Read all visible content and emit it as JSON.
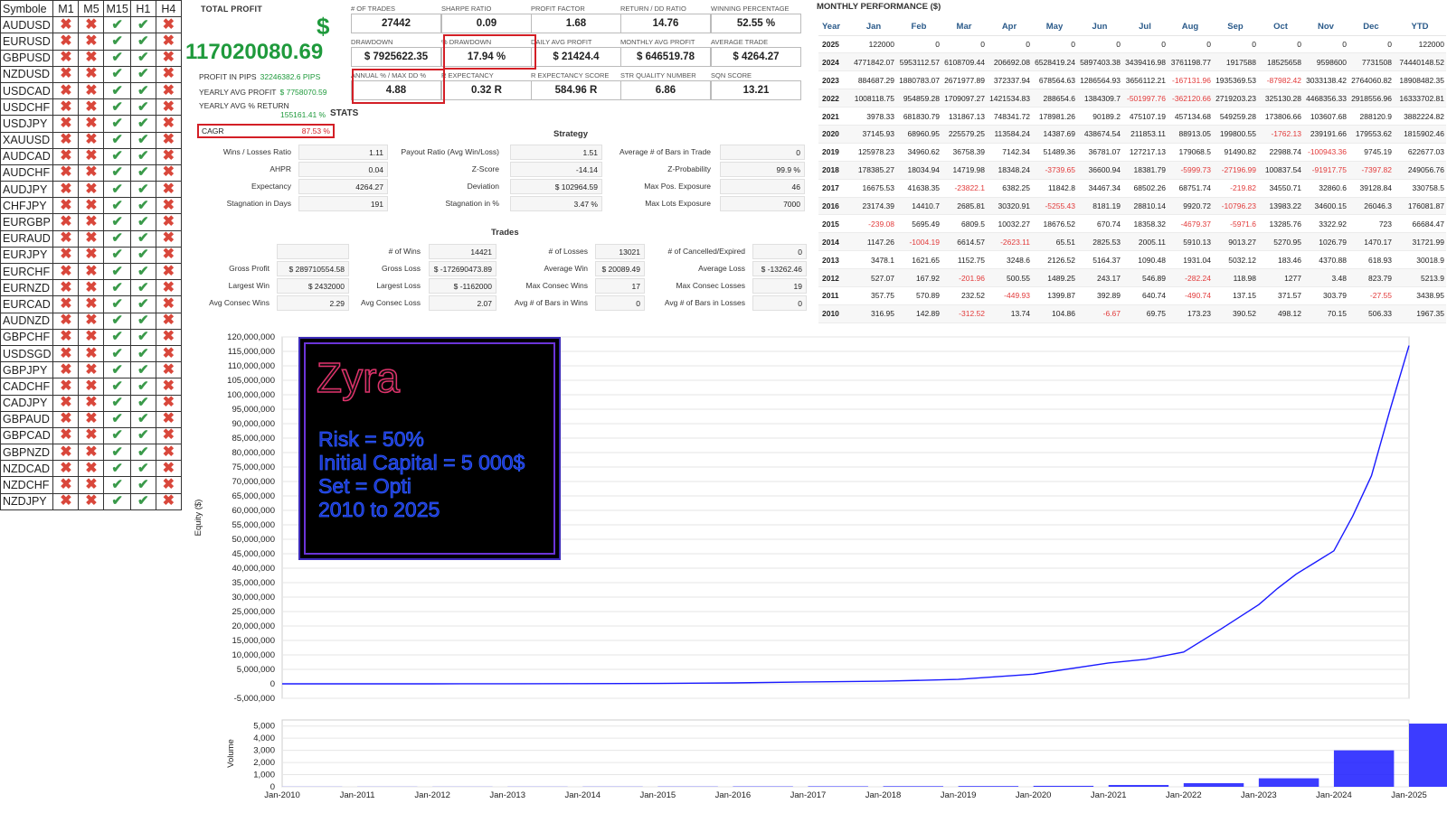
{
  "symbol_table": {
    "headers": [
      "Symbole",
      "M1",
      "M5",
      "M15",
      "H1",
      "H4"
    ],
    "rows": [
      {
        "symbol": "AUDUSD",
        "marks": [
          "x",
          "x",
          "ok",
          "ok",
          "x"
        ]
      },
      {
        "symbol": "EURUSD",
        "marks": [
          "x",
          "x",
          "ok",
          "ok",
          "x"
        ]
      },
      {
        "symbol": "GBPUSD",
        "marks": [
          "x",
          "x",
          "ok",
          "ok",
          "x"
        ]
      },
      {
        "symbol": "NZDUSD",
        "marks": [
          "x",
          "x",
          "ok",
          "ok",
          "x"
        ]
      },
      {
        "symbol": "USDCAD",
        "marks": [
          "x",
          "x",
          "ok",
          "ok",
          "x"
        ]
      },
      {
        "symbol": "USDCHF",
        "marks": [
          "x",
          "x",
          "ok",
          "ok",
          "x"
        ]
      },
      {
        "symbol": "USDJPY",
        "marks": [
          "x",
          "x",
          "ok",
          "ok",
          "x"
        ]
      },
      {
        "symbol": "XAUUSD",
        "marks": [
          "x",
          "x",
          "ok",
          "ok",
          "x"
        ]
      },
      {
        "symbol": "AUDCAD",
        "marks": [
          "x",
          "x",
          "ok",
          "ok",
          "x"
        ]
      },
      {
        "symbol": "AUDCHF",
        "marks": [
          "x",
          "x",
          "ok",
          "ok",
          "x"
        ]
      },
      {
        "symbol": "AUDJPY",
        "marks": [
          "x",
          "x",
          "ok",
          "ok",
          "x"
        ]
      },
      {
        "symbol": "CHFJPY",
        "marks": [
          "x",
          "x",
          "ok",
          "ok",
          "x"
        ]
      },
      {
        "symbol": "EURGBP",
        "marks": [
          "x",
          "x",
          "ok",
          "ok",
          "x"
        ]
      },
      {
        "symbol": "EURAUD",
        "marks": [
          "x",
          "x",
          "ok",
          "ok",
          "x"
        ]
      },
      {
        "symbol": "EURJPY",
        "marks": [
          "x",
          "x",
          "ok",
          "ok",
          "x"
        ]
      },
      {
        "symbol": "EURCHF",
        "marks": [
          "x",
          "x",
          "ok",
          "ok",
          "x"
        ]
      },
      {
        "symbol": "EURNZD",
        "marks": [
          "x",
          "x",
          "ok",
          "ok",
          "x"
        ]
      },
      {
        "symbol": "EURCAD",
        "marks": [
          "x",
          "x",
          "ok",
          "ok",
          "x"
        ]
      },
      {
        "symbol": "AUDNZD",
        "marks": [
          "x",
          "x",
          "ok",
          "ok",
          "x"
        ]
      },
      {
        "symbol": "GBPCHF",
        "marks": [
          "x",
          "x",
          "ok",
          "ok",
          "x"
        ]
      },
      {
        "symbol": "USDSGD",
        "marks": [
          "x",
          "x",
          "ok",
          "ok",
          "x"
        ]
      },
      {
        "symbol": "GBPJPY",
        "marks": [
          "x",
          "x",
          "ok",
          "ok",
          "x"
        ]
      },
      {
        "symbol": "CADCHF",
        "marks": [
          "x",
          "x",
          "ok",
          "ok",
          "x"
        ]
      },
      {
        "symbol": "CADJPY",
        "marks": [
          "x",
          "x",
          "ok",
          "ok",
          "x"
        ]
      },
      {
        "symbol": "GBPAUD",
        "marks": [
          "x",
          "x",
          "ok",
          "ok",
          "x"
        ]
      },
      {
        "symbol": "GBPCAD",
        "marks": [
          "x",
          "x",
          "ok",
          "ok",
          "x"
        ]
      },
      {
        "symbol": "GBPNZD",
        "marks": [
          "x",
          "x",
          "ok",
          "ok",
          "x"
        ]
      },
      {
        "symbol": "NZDCAD",
        "marks": [
          "x",
          "x",
          "ok",
          "ok",
          "x"
        ]
      },
      {
        "symbol": "NZDCHF",
        "marks": [
          "x",
          "x",
          "ok",
          "ok",
          "x"
        ]
      },
      {
        "symbol": "NZDJPY",
        "marks": [
          "x",
          "x",
          "ok",
          "ok",
          "x"
        ]
      }
    ]
  },
  "total_profit": {
    "title": "TOTAL PROFIT",
    "currency": "$",
    "value": "117020080.69",
    "pips_label": "PROFIT IN PIPS",
    "pips_value": "32246382.6 PIPS",
    "yearly_avg_label": "YEARLY AVG PROFIT",
    "yearly_avg_value": "$ 7758070.59",
    "yearly_ret_label": "YEARLY AVG % RETURN",
    "yearly_ret_value": "155161.41 %",
    "stats_heading": "STATS",
    "cagr_label": "CAGR",
    "cagr_value": "87.53 %"
  },
  "metrics": [
    {
      "label": "# OF TRADES",
      "value": "27442"
    },
    {
      "label": "SHARPE RATIO",
      "value": "0.09"
    },
    {
      "label": "PROFIT FACTOR",
      "value": "1.68"
    },
    {
      "label": "RETURN / DD RATIO",
      "value": "14.76"
    },
    {
      "label": "WINNING PERCENTAGE",
      "value": "52.55 %"
    },
    {
      "label": "DRAWDOWN",
      "value": "$ 7925622.35"
    },
    {
      "label": "% DRAWDOWN",
      "value": "17.94 %"
    },
    {
      "label": "DAILY AVG PROFIT",
      "value": "$ 21424.4"
    },
    {
      "label": "MONTHLY AVG PROFIT",
      "value": "$ 646519.78"
    },
    {
      "label": "AVERAGE TRADE",
      "value": "$ 4264.27"
    },
    {
      "label": "ANNUAL % / MAX DD %",
      "value": "4.88"
    },
    {
      "label": "R EXPECTANCY",
      "value": "0.32 R"
    },
    {
      "label": "R EXPECTANCY SCORE",
      "value": "584.96 R"
    },
    {
      "label": "STR QUALITY NUMBER",
      "value": "6.86"
    },
    {
      "label": "SQN SCORE",
      "value": "13.21"
    }
  ],
  "strategy": {
    "title": "Strategy",
    "items": [
      {
        "label": "Wins / Losses Ratio",
        "value": "1.11"
      },
      {
        "label": "Payout Ratio (Avg Win/Loss)",
        "value": "1.51"
      },
      {
        "label": "Average # of Bars in Trade",
        "value": "0"
      },
      {
        "label": "AHPR",
        "value": "0.04"
      },
      {
        "label": "Z-Score",
        "value": "-14.14"
      },
      {
        "label": "Z-Probability",
        "value": "99.9 %"
      },
      {
        "label": "Expectancy",
        "value": "4264.27"
      },
      {
        "label": "Deviation",
        "value": "$ 102964.59"
      },
      {
        "label": "Max Pos. Exposure",
        "value": "46"
      },
      {
        "label": "Stagnation in Days",
        "value": "191"
      },
      {
        "label": "Stagnation in %",
        "value": "3.47 %"
      },
      {
        "label": "Max Lots Exposure",
        "value": "7000"
      }
    ]
  },
  "trades": {
    "title": "Trades",
    "items": [
      {
        "label": "",
        "value": ""
      },
      {
        "label": "# of Wins",
        "value": "14421"
      },
      {
        "label": "# of Losses",
        "value": "13021"
      },
      {
        "label": "# of Cancelled/Expired",
        "value": "0"
      },
      {
        "label": "Gross Profit",
        "value": "$ 289710554.58"
      },
      {
        "label": "Gross Loss",
        "value": "$ -172690473.89"
      },
      {
        "label": "Average Win",
        "value": "$ 20089.49"
      },
      {
        "label": "Average Loss",
        "value": "$ -13262.46"
      },
      {
        "label": "Largest Win",
        "value": "$ 2432000"
      },
      {
        "label": "Largest Loss",
        "value": "$ -1162000"
      },
      {
        "label": "Max Consec Wins",
        "value": "17"
      },
      {
        "label": "Max Consec Losses",
        "value": "19"
      },
      {
        "label": "Avg Consec Wins",
        "value": "2.29"
      },
      {
        "label": "Avg Consec Loss",
        "value": "2.07"
      },
      {
        "label": "Avg # of Bars in Wins",
        "value": "0"
      },
      {
        "label": "Avg # of Bars in Losses",
        "value": "0"
      }
    ]
  },
  "monthly": {
    "title": "MONTHLY PERFORMANCE ($)",
    "headers": [
      "Year",
      "Jan",
      "Feb",
      "Mar",
      "Apr",
      "May",
      "Jun",
      "Jul",
      "Aug",
      "Sep",
      "Oct",
      "Nov",
      "Dec",
      "YTD"
    ],
    "rows": [
      [
        "2025",
        "122000",
        "0",
        "0",
        "0",
        "0",
        "0",
        "0",
        "0",
        "0",
        "0",
        "0",
        "0",
        "122000"
      ],
      [
        "2024",
        "4771842.07",
        "5953112.57",
        "6108709.44",
        "206692.08",
        "6528419.24",
        "5897403.38",
        "3439416.98",
        "3761198.77",
        "1917588",
        "18525658",
        "9598600",
        "7731508",
        "74440148.52"
      ],
      [
        "2023",
        "884687.29",
        "1880783.07",
        "2671977.89",
        "372337.94",
        "678564.63",
        "1286564.93",
        "3656112.21",
        "-167131.96",
        "1935369.53",
        "-87982.42",
        "3033138.42",
        "2764060.82",
        "18908482.35"
      ],
      [
        "2022",
        "1008118.75",
        "954859.28",
        "1709097.27",
        "1421534.83",
        "288654.6",
        "1384309.7",
        "-501997.76",
        "-362120.66",
        "2719203.23",
        "325130.28",
        "4468356.33",
        "2918556.96",
        "16333702.81"
      ],
      [
        "2021",
        "3978.33",
        "681830.79",
        "131867.13",
        "748341.72",
        "178981.26",
        "90189.2",
        "475107.19",
        "457134.68",
        "549259.28",
        "173806.66",
        "103607.68",
        "288120.9",
        "3882224.82"
      ],
      [
        "2020",
        "37145.93",
        "68960.95",
        "225579.25",
        "113584.24",
        "14387.69",
        "438674.54",
        "211853.11",
        "88913.05",
        "199800.55",
        "-1762.13",
        "239191.66",
        "179553.62",
        "1815902.46"
      ],
      [
        "2019",
        "125978.23",
        "34960.62",
        "36758.39",
        "7142.34",
        "51489.36",
        "36781.07",
        "127217.13",
        "179068.5",
        "91490.82",
        "22988.74",
        "-100943.36",
        "9745.19",
        "622677.03"
      ],
      [
        "2018",
        "178385.27",
        "18034.94",
        "14719.98",
        "18348.24",
        "-3739.65",
        "36600.94",
        "18381.79",
        "-5999.73",
        "-27196.99",
        "100837.54",
        "-91917.75",
        "-7397.82",
        "249056.76"
      ],
      [
        "2017",
        "16675.53",
        "41638.35",
        "-23822.1",
        "6382.25",
        "11842.8",
        "34467.34",
        "68502.26",
        "68751.74",
        "-219.82",
        "34550.71",
        "32860.6",
        "39128.84",
        "330758.5"
      ],
      [
        "2016",
        "23174.39",
        "14410.7",
        "2685.81",
        "30320.91",
        "-5255.43",
        "8181.19",
        "28810.14",
        "9920.72",
        "-10796.23",
        "13983.22",
        "34600.15",
        "26046.3",
        "176081.87"
      ],
      [
        "2015",
        "-239.08",
        "5695.49",
        "6809.5",
        "10032.27",
        "18676.52",
        "670.74",
        "18358.32",
        "-4679.37",
        "-5971.6",
        "13285.76",
        "3322.92",
        "723",
        "66684.47"
      ],
      [
        "2014",
        "1147.26",
        "-1004.19",
        "6614.57",
        "-2623.11",
        "65.51",
        "2825.53",
        "2005.11",
        "5910.13",
        "9013.27",
        "5270.95",
        "1026.79",
        "1470.17",
        "31721.99"
      ],
      [
        "2013",
        "3478.1",
        "1621.65",
        "1152.75",
        "3248.6",
        "2126.52",
        "5164.37",
        "1090.48",
        "1931.04",
        "5032.12",
        "183.46",
        "4370.88",
        "618.93",
        "30018.9"
      ],
      [
        "2012",
        "527.07",
        "167.92",
        "-201.96",
        "500.55",
        "1489.25",
        "243.17",
        "546.89",
        "-282.24",
        "118.98",
        "1277",
        "3.48",
        "823.79",
        "5213.9"
      ],
      [
        "2011",
        "357.75",
        "570.89",
        "232.52",
        "-449.93",
        "1399.87",
        "392.89",
        "640.74",
        "-490.74",
        "137.15",
        "371.57",
        "303.79",
        "-27.55",
        "3438.95"
      ],
      [
        "2010",
        "316.95",
        "142.89",
        "-312.52",
        "13.74",
        "104.86",
        "-6.67",
        "69.75",
        "173.23",
        "390.52",
        "498.12",
        "70.15",
        "506.33",
        "1967.35"
      ]
    ]
  },
  "overlay": {
    "name": "Zyra",
    "lines": [
      "Risk = 50%",
      "Initial Capital = 5 000$",
      "Set = Opti",
      "2010 to 2025"
    ],
    "colors": {
      "name_stroke": "#e0336c",
      "text": "#2f63ff",
      "border": "#6b34d8"
    }
  },
  "chart_data": [
    {
      "type": "line",
      "title": "",
      "ylabel": "Equity ($)",
      "xlabel": "",
      "ylim": [
        -5000000,
        120000000
      ],
      "yticks": [
        "120,000,000",
        "115,000,000",
        "110,000,000",
        "105,000,000",
        "100,000,000",
        "95,000,000",
        "90,000,000",
        "85,000,000",
        "80,000,000",
        "75,000,000",
        "70,000,000",
        "65,000,000",
        "60,000,000",
        "55,000,000",
        "50,000,000",
        "45,000,000",
        "40,000,000",
        "35,000,000",
        "30,000,000",
        "25,000,000",
        "20,000,000",
        "15,000,000",
        "10,000,000",
        "5,000,000",
        "0",
        "-5,000,000"
      ],
      "color": "#1a1aff",
      "grid": true,
      "x": [
        "2010-01",
        "2011-01",
        "2012-01",
        "2013-01",
        "2014-01",
        "2015-01",
        "2016-01",
        "2017-01",
        "2018-01",
        "2019-01",
        "2020-01",
        "2021-01",
        "2021-07",
        "2022-01",
        "2022-07",
        "2023-01",
        "2023-04",
        "2023-07",
        "2023-10",
        "2024-01",
        "2024-04",
        "2024-07",
        "2024-10",
        "2025-01"
      ],
      "y": [
        5000,
        7000,
        12000,
        42000,
        74000,
        140000,
        316000,
        647000,
        896000,
        1518000,
        3334000,
        7216000,
        8500000,
        11000000,
        19000000,
        27400000,
        33000000,
        38000000,
        42000000,
        46000000,
        58000000,
        72000000,
        95000000,
        117000000
      ]
    },
    {
      "type": "bar",
      "title": "",
      "ylabel": "Volume",
      "xlabel": "",
      "ylim": [
        0,
        5500
      ],
      "yticks": [
        "5,000",
        "4,000",
        "3,000",
        "2,000",
        "1,000",
        "0"
      ],
      "color": "#1a1aff",
      "xticks": [
        "Jan-2010",
        "Jan-2011",
        "Jan-2012",
        "Jan-2013",
        "Jan-2014",
        "Jan-2015",
        "Jan-2016",
        "Jan-2017",
        "Jan-2018",
        "Jan-2019",
        "Jan-2020",
        "Jan-2021",
        "Jan-2022",
        "Jan-2023",
        "Jan-2024",
        "Jan-2025"
      ],
      "x": [
        "2010",
        "2011",
        "2012",
        "2013",
        "2014",
        "2015",
        "2016",
        "2017",
        "2018",
        "2019",
        "2020",
        "2021",
        "2022",
        "2023",
        "2024",
        "2025"
      ],
      "values": [
        10,
        10,
        10,
        12,
        15,
        20,
        30,
        40,
        50,
        60,
        80,
        150,
        300,
        700,
        3000,
        5200
      ]
    }
  ]
}
